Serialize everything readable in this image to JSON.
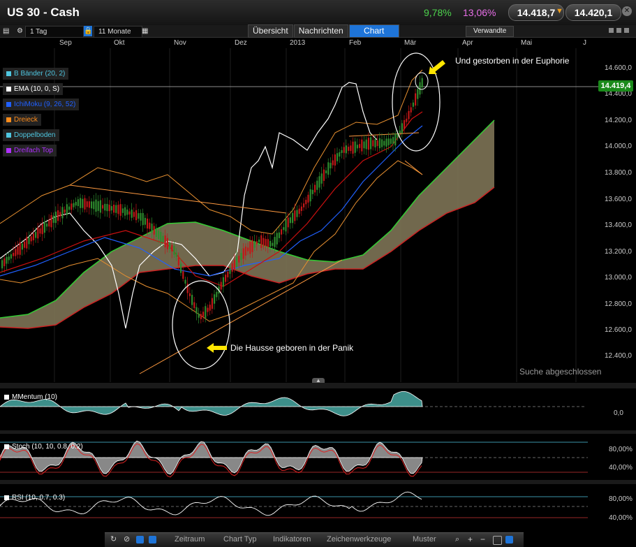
{
  "header": {
    "title": "US 30 - Cash",
    "change_pct_1": "9,78%",
    "change_pct_2": "13,06%",
    "bid": "14.418,7",
    "ask": "14.420,1"
  },
  "toolbar": {
    "interval": "1 Tag",
    "range": "11 Monate",
    "tabs": [
      "Übersicht",
      "Nachrichten",
      "Chart"
    ],
    "active_tab": "Chart",
    "related": "Verwandte"
  },
  "chart": {
    "months": [
      "Sep",
      "Okt",
      "Nov",
      "Dez",
      "2013",
      "Feb",
      "Mär",
      "Apr",
      "Mai",
      "J"
    ],
    "indicators": [
      {
        "label": "B Bänder (20, 2)",
        "color": "#4fc6e0"
      },
      {
        "label": "EMA (10, 0, S)",
        "color": "#ffffff"
      },
      {
        "label": "IchiMoku (9, 26, 52)",
        "color": "#2060ff"
      },
      {
        "label": "Dreieck",
        "color": "#ff8c1a"
      },
      {
        "label": "Doppelboden",
        "color": "#4fc6e0"
      },
      {
        "label": "Dreifach Top",
        "color": "#b030ff"
      }
    ],
    "y_labels": [
      "14.600,0",
      "14.400,0",
      "14.200,0",
      "14.000,0",
      "13.800,0",
      "13.600,0",
      "13.400,0",
      "13.200,0",
      "13.000,0",
      "12.800,0",
      "12.600,0",
      "12.400,0"
    ],
    "current_price": "14.419,4",
    "annotation_top": "Und gestorben in der Euphorie",
    "annotation_bottom": "Die Hausse geboren in der Panik",
    "search_status": "Suche abgeschlossen",
    "accent_up": "#2e8b2e",
    "accent_down": "#c01818"
  },
  "subpanels": {
    "momentum": {
      "label": "MMentum (10)",
      "y_label": "0,0"
    },
    "stoch": {
      "label": "Stoch (10, 10, 0.8, 0.2)",
      "y_labels": [
        "80,00%",
        "40,00%"
      ]
    },
    "rsi": {
      "label": "RSI (10, 0.7, 0.3)",
      "y_labels": [
        "80,00%",
        "40,00%"
      ]
    }
  },
  "bottombar": {
    "items": [
      "Zeitraum",
      "Chart Typ",
      "Indikatoren",
      "Zeichenwerkzeuge",
      "Muster"
    ]
  }
}
